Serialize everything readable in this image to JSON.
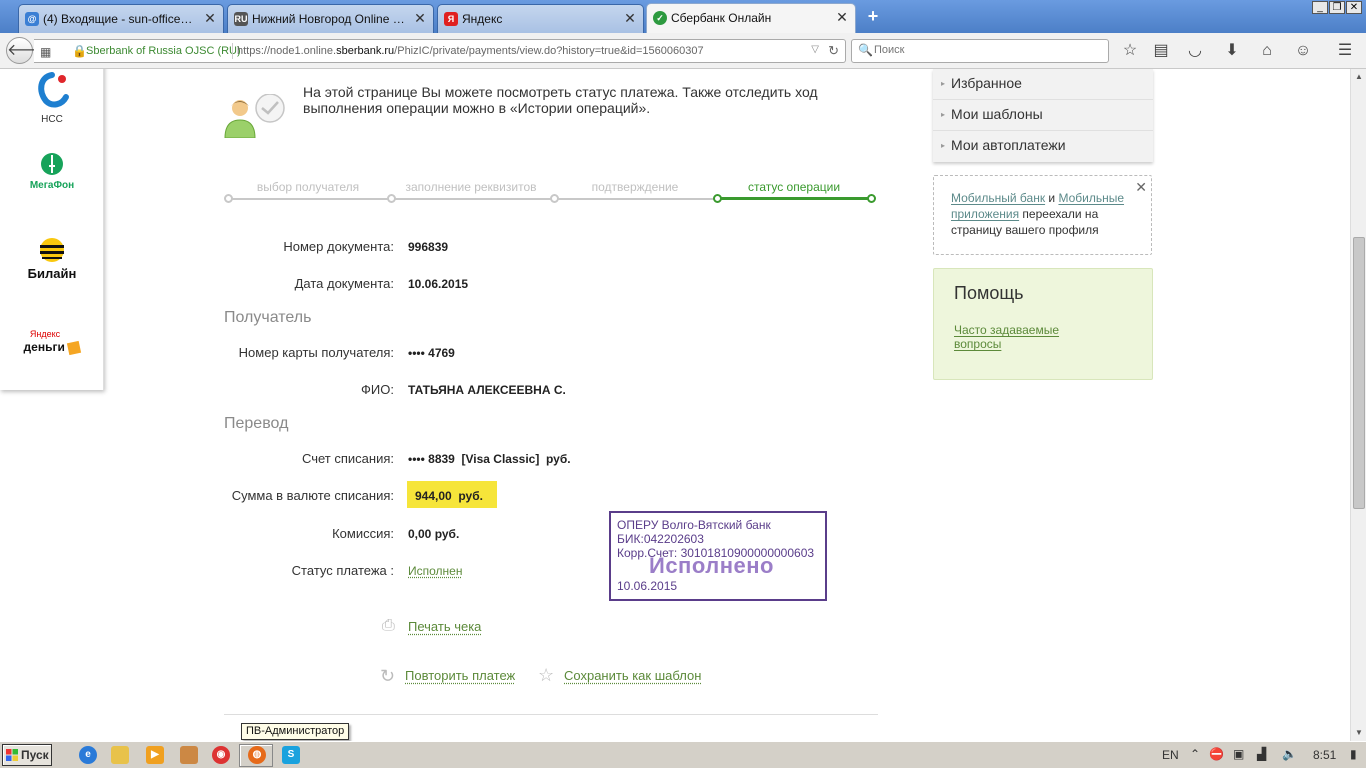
{
  "browser": {
    "tabs": [
      {
        "title": "(4) Входящие - sun-office@b...",
        "icon": "mail-icon"
      },
      {
        "title": "Нижний Новгород Online - Н...",
        "icon": "ru-icon",
        "icon_text": "RU"
      },
      {
        "title": "Яндекс",
        "icon": "yandex-icon",
        "icon_text": "Я"
      },
      {
        "title": "Сбербанк Онлайн",
        "icon": "sberbank-icon",
        "active": true
      }
    ],
    "identity": "Sberbank of Russia OJSC (RU)",
    "url_prefix": "https://node1.online.",
    "url_domain": "sberbank.ru",
    "url_suffix": "/PhizIC/private/payments/view.do?history=true&id=1560060307",
    "search_placeholder": "Поиск"
  },
  "operators": [
    {
      "name": "НСС"
    },
    {
      "name": "МегаФон"
    },
    {
      "name": "Билайн"
    },
    {
      "name": "Яндекс",
      "sub": "деньги"
    }
  ],
  "info_text": "На этой странице Вы можете посмотреть статус платежа. Также отследить ход выполнения операции можно в «Истории операций».",
  "steps": [
    {
      "label": "выбор получателя",
      "current": false
    },
    {
      "label": "заполнение реквизитов",
      "current": false
    },
    {
      "label": "подтверждение",
      "current": false
    },
    {
      "label": "статус операции",
      "current": true
    }
  ],
  "document": {
    "number_label": "Номер документа:",
    "number": "996839",
    "date_label": "Дата документа:",
    "date": "10.06.2015"
  },
  "recipient": {
    "section": "Получатель",
    "card_label": "Номер карты получателя:",
    "card": "•••• 4769",
    "name_label": "ФИО:",
    "name": "ТАТЬЯНА АЛЕКСЕЕВНА С."
  },
  "transfer": {
    "section": "Перевод",
    "account_label": "Счет списания:",
    "account": "•••• 8839  [Visa Classic]  руб.",
    "amount_label": "Сумма в валюте списания:",
    "amount": "944,00  руб.",
    "fee_label": "Комиссия:",
    "fee": "0,00 руб.",
    "status_label": "Статус платежа :",
    "status": "Исполнен"
  },
  "stamp": {
    "line1": "ОПЕРУ Волго-Вятский банк",
    "line2": "БИК:042202603",
    "line3": "Корр.Счет: 30101810900000000603",
    "status": "Исполнено",
    "date": "10.06.2015"
  },
  "actions": {
    "print": "Печать чека",
    "repeat": "Повторить платеж",
    "save_template": "Сохранить как шаблон"
  },
  "tooltip": "ПВ-Администратор",
  "sidebar": {
    "menu": [
      "Избранное",
      "Мои шаблоны",
      "Мои автоплатежи"
    ],
    "notice": {
      "link1": "Мобильный банк",
      "and": " и ",
      "link2": "Мобильные приложения",
      "rest": " переехали на страницу вашего профиля"
    },
    "help_title": "Помощь",
    "help_link": "Часто задаваемые вопросы"
  },
  "taskbar": {
    "start": "Пуск",
    "lang": "EN",
    "clock": "8:51"
  },
  "colors": {
    "accent_green": "#3a9a2e",
    "link_green": "#5c8a3a",
    "highlight_yellow": "#f6e53a",
    "stamp_purple": "#5a3d8a"
  }
}
